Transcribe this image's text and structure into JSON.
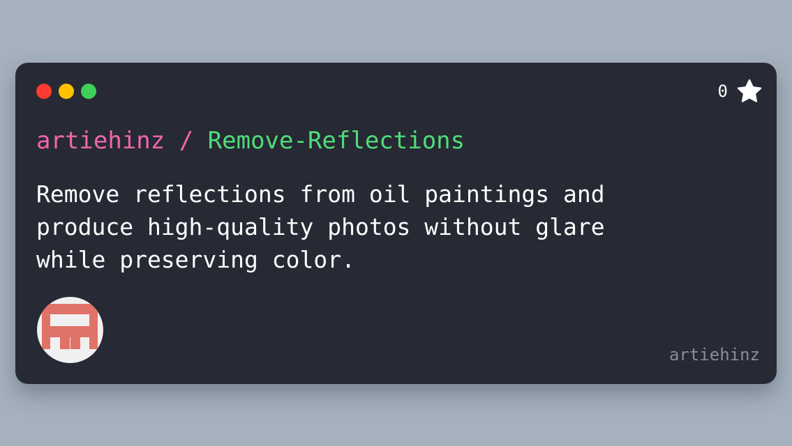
{
  "window_controls": {
    "close_color": "#fe3b30",
    "minimize_color": "#fec200",
    "maximize_color": "#3fd05a"
  },
  "stars": {
    "count": "0",
    "icon": "star-icon"
  },
  "repo": {
    "owner": "artiehinz",
    "separator": " / ",
    "name": "Remove-Reflections",
    "owner_color": "#ef67ab",
    "separator_color": "#ef67ab",
    "name_color": "#4fde77"
  },
  "description": "Remove reflections from oil paintings and produce high-quality photos without glare while preserving color.",
  "author": {
    "avatar_icon": "identicon-avatar",
    "avatar_color": "#e07268",
    "username": "artiehinz"
  }
}
